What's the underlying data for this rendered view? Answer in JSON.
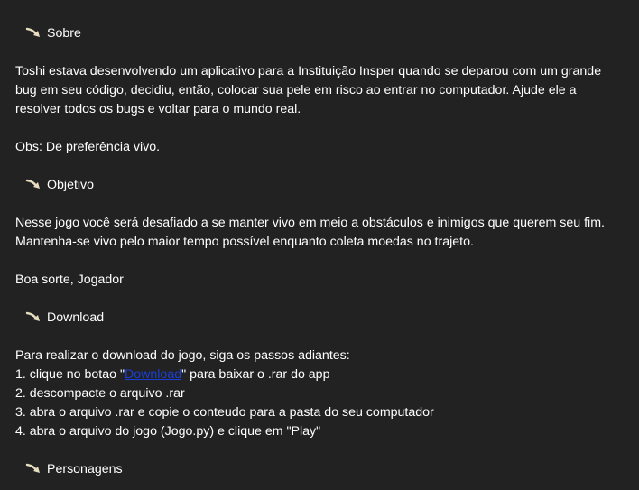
{
  "sections": {
    "sobre": {
      "title": "Sobre",
      "lines": [
        "Toshi estava desenvolvendo um aplicativo para a Instituição Insper quando se deparou com um grande",
        "bug em seu código, decidiu, então, colocar sua pele em risco ao entrar no computador. Ajude ele a",
        "resolver todos os bugs e voltar para o mundo real."
      ],
      "obs": "Obs: De preferência vivo."
    },
    "objetivo": {
      "title": "Objetivo",
      "lines": [
        "Nesse jogo você será desafiado a se manter vivo em meio a obstáculos e inimigos que querem seu fim.",
        "Mantenha-se vivo pelo maior tempo possível enquanto coleta moedas no trajeto."
      ],
      "farewell": "Boa sorte, Jogador"
    },
    "download": {
      "title": "Download",
      "intro": "Para realizar o download do jogo, siga os passos adiantes:",
      "step1_prefix": "1. clique no botao \"",
      "step1_link": "Download",
      "step1_suffix": "\" para baixar o .rar do app",
      "step2": "2. descompacte o arquivo .rar",
      "step3": "3. abra o arquivo .rar e copie o conteudo para a pasta do seu computador",
      "step4": "4. abra o arquivo do jogo (Jogo.py) e clique em \"Play\""
    },
    "personagens": {
      "title": "Personagens"
    }
  },
  "colors": {
    "background": "#222222",
    "text": "#ffffff",
    "link": "#1a3fd6",
    "arrow": "#e8dcc0"
  },
  "icons": {
    "section_heading": "curved-arrow-icon"
  }
}
